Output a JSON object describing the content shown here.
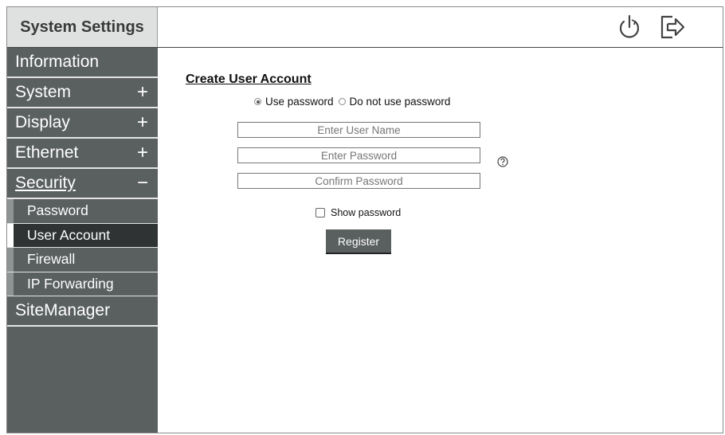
{
  "app": {
    "title": "System Settings"
  },
  "topbar": {
    "power_icon": "power-icon",
    "logout_icon": "logout-icon"
  },
  "sidebar": {
    "items": [
      {
        "label": "Information",
        "sign": ""
      },
      {
        "label": "System",
        "sign": "+"
      },
      {
        "label": "Display",
        "sign": "+"
      },
      {
        "label": "Ethernet",
        "sign": "+"
      },
      {
        "label": "Security",
        "sign": "−"
      }
    ],
    "security_sub": [
      {
        "label": "Password"
      },
      {
        "label": "User Account"
      },
      {
        "label": "Firewall"
      },
      {
        "label": "IP Forwarding"
      }
    ],
    "last_item": {
      "label": "SiteManager"
    }
  },
  "form": {
    "heading": "Create User Account",
    "radio_use": "Use password",
    "radio_no": "Do not use password",
    "user_placeholder": "Enter User Name",
    "password_placeholder": "Enter Password",
    "confirm_placeholder": "Confirm Password",
    "show_password_label": "Show password",
    "register_label": "Register"
  },
  "colors": {
    "sidebar_bg": "#5a5f60",
    "selected_bg": "#2f3334",
    "title_bg": "#dfe1e1"
  }
}
